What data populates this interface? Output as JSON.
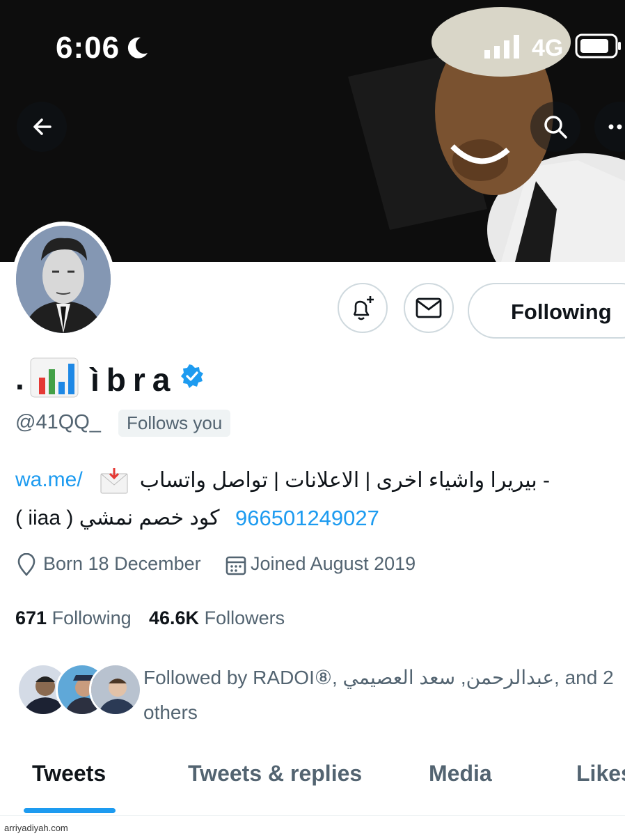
{
  "status_bar": {
    "time": "6:06",
    "network": "4G"
  },
  "profile": {
    "name_prefix": ".",
    "name": "ìbra",
    "handle": "@41QQ_",
    "follows_you": "Follows you",
    "following_button": "Following",
    "bio_line1": "- بيريرا واشياء اخرى | الاعلانات | تواصل واتساب",
    "bio_link": "wa.me/",
    "bio_line2": "كود خصم نمشي ( iiaa )",
    "bio_phone": "966501249027",
    "born": "Born 18 December",
    "joined": "Joined August 2019",
    "following_count": "671",
    "following_label": "Following",
    "followers_count": "46.6K",
    "followers_label": "Followers",
    "followed_by": "Followed by RADOI⑧, عبدالرحمن, سعد العصيمي, and 2 others"
  },
  "tabs": [
    {
      "label": "Tweets"
    },
    {
      "label": "Tweets & replies"
    },
    {
      "label": "Media"
    },
    {
      "label": "Likes"
    }
  ],
  "icons": [
    "back-arrow-icon",
    "search-icon",
    "more-icon",
    "notify-plus-icon",
    "message-icon",
    "verified-icon",
    "location-pin-icon",
    "calendar-icon"
  ],
  "colors": {
    "accent": "#1d9bf0",
    "secondary_text": "#536471",
    "text": "#0f1419"
  },
  "watermark": "arriyadiyah.com"
}
